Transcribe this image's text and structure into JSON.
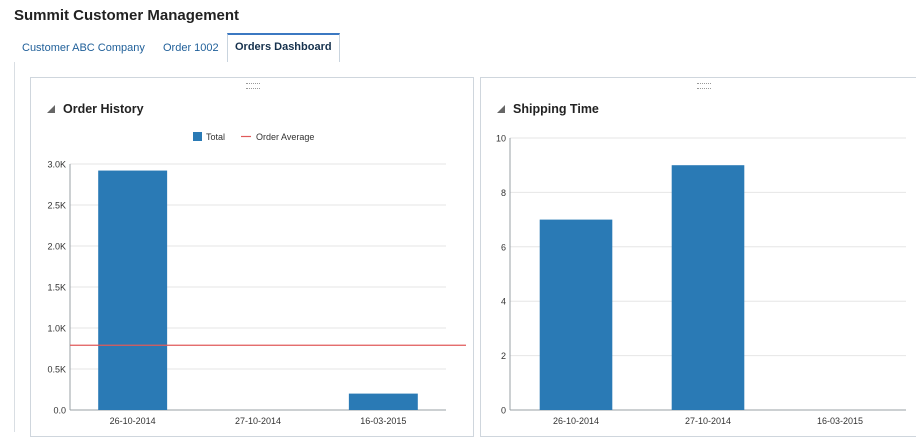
{
  "app": {
    "title": "Summit Customer Management"
  },
  "tabs": [
    {
      "label": "Customer ABC Company",
      "active": false
    },
    {
      "label": "Order 1002",
      "active": false
    },
    {
      "label": "Orders Dashboard",
      "active": true
    }
  ],
  "colors": {
    "bar": "#2a7ab5",
    "average": "#e05a5a",
    "grid": "#e6e6e6",
    "tab_accent": "#3b78c2"
  },
  "panels": {
    "order_history": {
      "title": "Order History",
      "collapse_icon": "collapse-triangle-icon"
    },
    "shipping_time": {
      "title": "Shipping Time",
      "collapse_icon": "collapse-triangle-icon"
    }
  },
  "chart_data": [
    {
      "type": "bar",
      "title": "Order History",
      "categories": [
        "26-10-2014",
        "27-10-2014",
        "16-03-2015"
      ],
      "series": [
        {
          "name": "Total",
          "values": [
            2920,
            0,
            200
          ]
        }
      ],
      "reference_lines": [
        {
          "name": "Order Average",
          "value": 790
        }
      ],
      "legend": [
        "Total",
        "Order Average"
      ],
      "legend_position": "top",
      "ylim": [
        0,
        3000
      ],
      "yticks": [
        0,
        500,
        1000,
        1500,
        2000,
        2500,
        3000
      ],
      "ytick_labels": [
        "0.0",
        "0.5K",
        "1.0K",
        "1.5K",
        "2.0K",
        "2.5K",
        "3.0K"
      ],
      "grid": true
    },
    {
      "type": "bar",
      "title": "Shipping Time",
      "categories": [
        "26-10-2014",
        "27-10-2014",
        "16-03-2015"
      ],
      "series": [
        {
          "values": [
            7,
            9,
            0
          ]
        }
      ],
      "ylim": [
        0,
        10
      ],
      "yticks": [
        0,
        2,
        4,
        6,
        8,
        10
      ],
      "ytick_labels": [
        "0",
        "2",
        "4",
        "6",
        "8",
        "10"
      ],
      "grid": true
    }
  ]
}
